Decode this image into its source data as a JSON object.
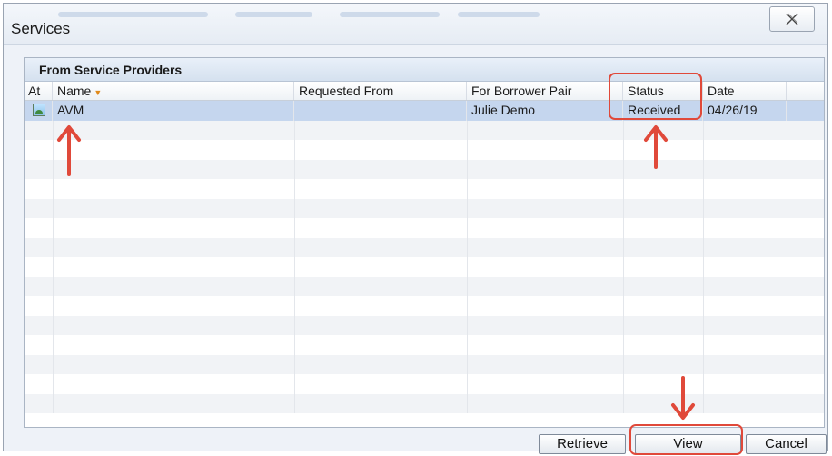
{
  "window": {
    "title": "Services",
    "ghost_tabs": [
      "",
      "",
      "",
      ""
    ]
  },
  "panel": {
    "title": "From Service Providers",
    "columns": {
      "at": "At",
      "name": "Name",
      "requested_from": "Requested From",
      "for_borrower_pair": "For Borrower Pair",
      "status": "Status",
      "date": "Date"
    },
    "rows": [
      {
        "name": "AVM",
        "requested_from": "",
        "for_borrower_pair": "Julie Demo",
        "status": "Received",
        "date": "04/26/19",
        "selected": true
      }
    ],
    "empty_row_count": 15
  },
  "buttons": {
    "retrieve": "Retrieve",
    "view": "View",
    "cancel": "Cancel"
  },
  "colors": {
    "annotation": "#e0493a",
    "selected_row": "#c5d6ee",
    "sort_arrow": "#e08a1c"
  },
  "icons": {
    "close": "close-x-icon",
    "attachment": "image-document-icon",
    "sort": "sort-desc-icon"
  }
}
